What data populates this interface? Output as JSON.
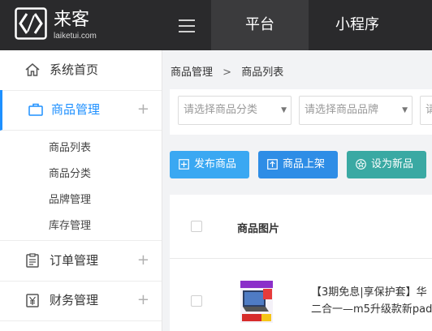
{
  "brand": {
    "name": "来客",
    "domain": "laiketui.com"
  },
  "topnav": {
    "tabs": [
      {
        "label": "平台",
        "active": true
      },
      {
        "label": "小程序",
        "active": false
      }
    ]
  },
  "sidebar": {
    "groups": [
      {
        "label": "系统首页",
        "icon": "home-icon"
      },
      {
        "label": "商品管理",
        "icon": "briefcase-icon",
        "active": true,
        "expand": "+"
      },
      {
        "label": "订单管理",
        "icon": "clipboard-icon",
        "expand": "+"
      },
      {
        "label": "财务管理",
        "icon": "yen-icon",
        "expand": "+"
      }
    ],
    "subitems": [
      "商品列表",
      "商品分类",
      "品牌管理",
      "库存管理"
    ]
  },
  "breadcrumb": {
    "parent": "商品管理",
    "separator": ">",
    "current": "商品列表"
  },
  "filters": {
    "category_placeholder": "请选择商品分类",
    "brand_placeholder": "请选择商品品牌",
    "third_placeholder": "请"
  },
  "actions": {
    "publish": {
      "label": "发布商品",
      "color": "#3aa8f2"
    },
    "shelve": {
      "label": "商品上架",
      "color": "#2e8de6"
    },
    "set_new": {
      "label": "设为新品",
      "color": "#3aa9a3"
    }
  },
  "table": {
    "headers": [
      "商品图片"
    ],
    "rows": [
      {
        "name_line1": "【3期免息|享保护套】华",
        "name_line2": "二合一—m5升级款新pad"
      }
    ]
  },
  "colors": {
    "topbar": "#2a2a2c",
    "accent": "#1e90ff",
    "page_bg": "#f2f3f5"
  }
}
